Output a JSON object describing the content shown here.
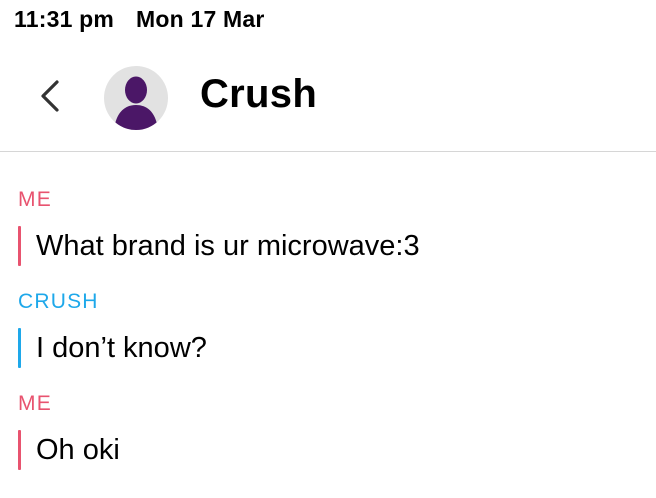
{
  "status_bar": {
    "time": "11:31 pm",
    "date": "Mon 17 Mar"
  },
  "header": {
    "back_icon": "chevron-left-icon",
    "avatar_icon": "person-silhouette-icon",
    "title": "Crush"
  },
  "colors": {
    "me": "#e8536f",
    "crush": "#1ea8ea",
    "avatar_bg": "#e2e2e2",
    "avatar_figure": "#4b1767",
    "divider": "#d6d6d6"
  },
  "messages": [
    {
      "sender": "ME",
      "text": "What brand is ur microwave:3"
    },
    {
      "sender": "CRUSH",
      "text": "I don’t know?"
    },
    {
      "sender": "ME",
      "text": "Oh oki"
    }
  ]
}
